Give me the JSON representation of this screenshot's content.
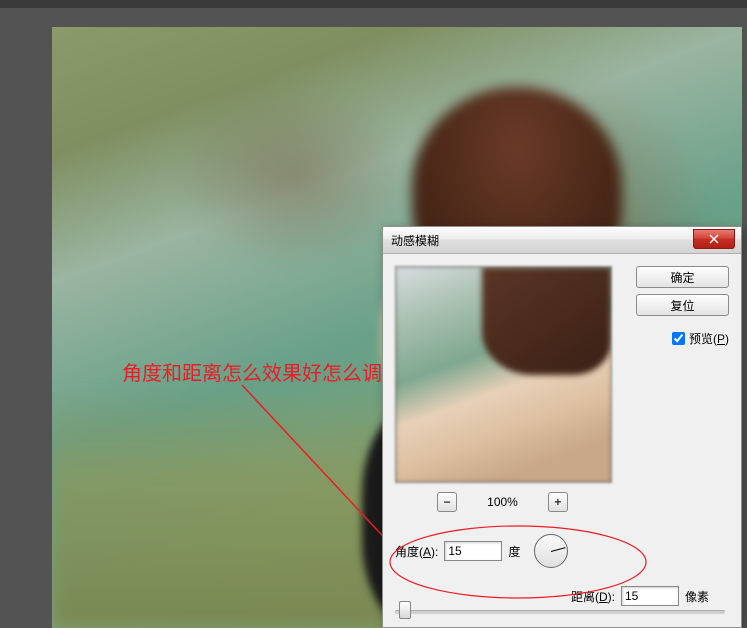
{
  "annotation": "角度和距离怎么效果好怎么调整",
  "dialog": {
    "title": "动感模糊",
    "ok": "确定",
    "reset": "复位",
    "preview_label": "预览(P)",
    "preview_checked": true,
    "zoom": "100%",
    "angle_label": "角度(A):",
    "angle_value": "15",
    "angle_unit": "度",
    "distance_label": "距离(D):",
    "distance_value": "15",
    "distance_unit": "像素",
    "minus": "−",
    "plus": "+"
  }
}
